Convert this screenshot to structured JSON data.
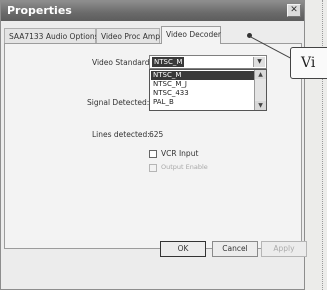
{
  "dialog": {
    "title": "Properties",
    "close_glyph": "✕"
  },
  "tabs": [
    {
      "label": "SAA7133 Audio Options",
      "active": false
    },
    {
      "label": "Video Proc Amp",
      "active": false
    },
    {
      "label": "Video Decoder",
      "active": true
    }
  ],
  "video_standard": {
    "label": "Video Standard:",
    "value": "NTSC_M",
    "options": [
      "NTSC_M",
      "NTSC_M_J",
      "NTSC_433",
      "PAL_B"
    ],
    "selected_index": 0
  },
  "signal_detected": {
    "label": "Signal Detected:"
  },
  "lines_detected": {
    "label": "Lines detected:",
    "value": "625"
  },
  "vcr_input": {
    "label": "VCR Input",
    "checked": false,
    "enabled": true
  },
  "output_enable": {
    "label": "Output Enable",
    "checked": false,
    "enabled": false
  },
  "buttons": {
    "ok": "OK",
    "cancel": "Cancel",
    "apply": "Apply"
  },
  "callout": {
    "text": "Vi"
  },
  "icons": {
    "combo_arrow": "chevron-down-icon",
    "scroll_up": "chevron-up-icon",
    "scroll_down": "chevron-down-icon"
  }
}
